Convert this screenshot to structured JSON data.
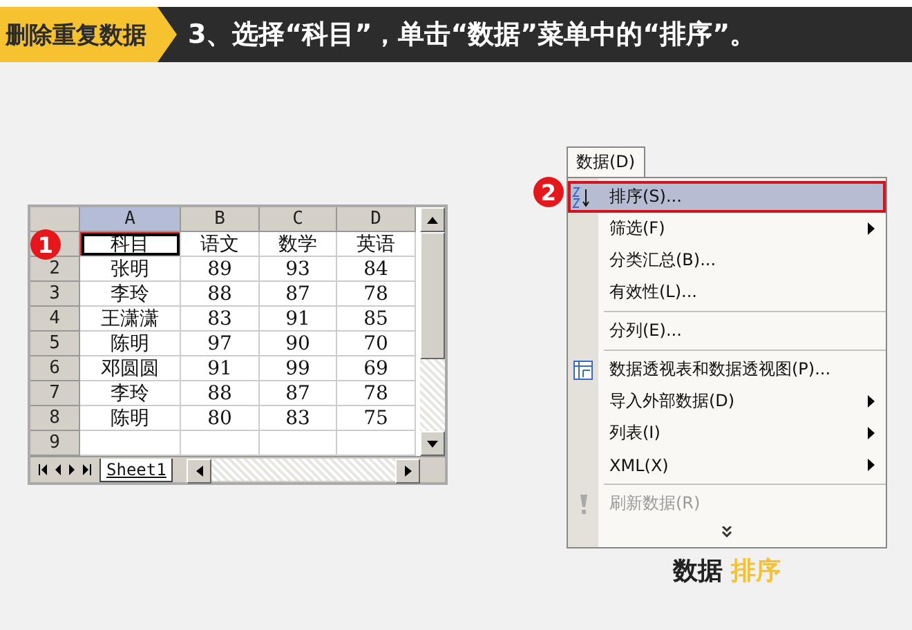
{
  "header": {
    "tag": "删除重复数据",
    "instruction": "3、选择“科目”，单击“数据”菜单中的“排序”。"
  },
  "sheet": {
    "step_marker": "1",
    "columns": [
      {
        "label": "A",
        "selected": true
      },
      {
        "label": "B",
        "selected": false
      },
      {
        "label": "C",
        "selected": false
      },
      {
        "label": "D",
        "selected": false
      }
    ],
    "rows": [
      {
        "cells": [
          "科目",
          "语文",
          "数学",
          "英语"
        ]
      },
      {
        "number": "2",
        "cells": [
          "张明",
          "89",
          "93",
          "84"
        ]
      },
      {
        "number": "3",
        "cells": [
          "李玲",
          "88",
          "87",
          "78"
        ]
      },
      {
        "number": "4",
        "cells": [
          "王潇潇",
          "83",
          "91",
          "85"
        ]
      },
      {
        "number": "5",
        "cells": [
          "陈明",
          "97",
          "90",
          "70"
        ]
      },
      {
        "number": "6",
        "cells": [
          "邓圆圆",
          "91",
          "99",
          "69"
        ]
      },
      {
        "number": "7",
        "cells": [
          "李玲",
          "88",
          "87",
          "78"
        ]
      },
      {
        "number": "8",
        "cells": [
          "陈明",
          "80",
          "83",
          "75"
        ]
      },
      {
        "number": "9"
      }
    ],
    "tabs": [
      {
        "label": "Sheet1",
        "selected": true
      }
    ]
  },
  "menu": {
    "title": "数据(D)",
    "step_marker": "2",
    "items": [
      {
        "kind": "sort",
        "label": "排序(S)...",
        "selected": true,
        "disabled": false,
        "submenu": false
      },
      {
        "kind": "item",
        "label": "筛选(F)",
        "selected": false,
        "disabled": false,
        "submenu": true
      },
      {
        "kind": "item",
        "label": "分类汇总(B)...",
        "selected": false,
        "disabled": false,
        "submenu": false
      },
      {
        "kind": "item",
        "label": "有效性(L)...",
        "selected": false,
        "disabled": false,
        "submenu": false
      },
      {
        "kind": "separator"
      },
      {
        "kind": "item",
        "label": "分列(E)...",
        "selected": false,
        "disabled": false,
        "submenu": false
      },
      {
        "kind": "separator"
      },
      {
        "kind": "pivot",
        "label": "数据透视表和数据透视图(P)...",
        "selected": false,
        "disabled": false,
        "submenu": false
      },
      {
        "kind": "item",
        "label": "导入外部数据(D)",
        "selected": false,
        "disabled": false,
        "submenu": true
      },
      {
        "kind": "item",
        "label": "列表(I)",
        "selected": false,
        "disabled": false,
        "submenu": true
      },
      {
        "kind": "item",
        "label": "XML(X)",
        "selected": false,
        "disabled": false,
        "submenu": true
      },
      {
        "kind": "separator"
      },
      {
        "kind": "refresh",
        "label": "刷新数据(R)",
        "selected": false,
        "disabled": true,
        "submenu": false
      },
      {
        "kind": "more"
      }
    ]
  },
  "caption": [
    {
      "kind": "plain",
      "text": "数据"
    },
    {
      "kind": "highlight",
      "text": "排序"
    }
  ]
}
